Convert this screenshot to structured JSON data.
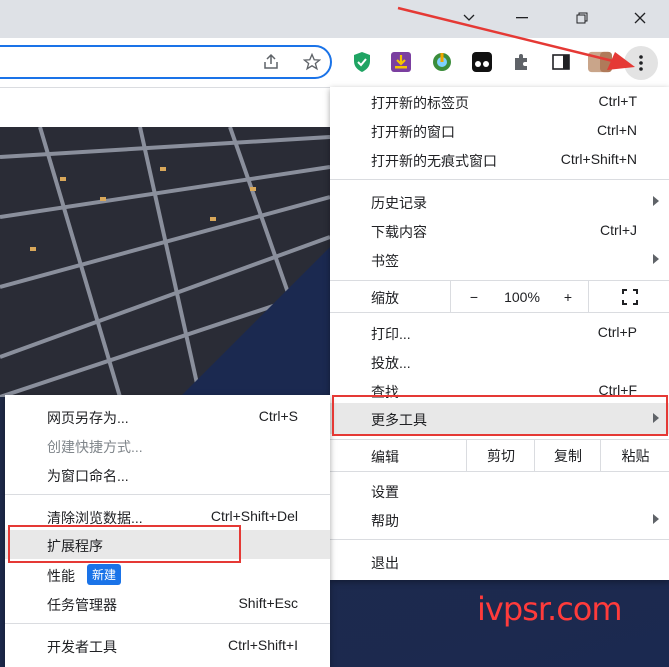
{
  "menu": {
    "items": [
      {
        "label": "打开新的标签页",
        "shortcut": "Ctrl+T"
      },
      {
        "label": "打开新的窗口",
        "shortcut": "Ctrl+N"
      },
      {
        "label": "打开新的无痕式窗口",
        "shortcut": "Ctrl+Shift+N"
      },
      {
        "label": "历史记录",
        "shortcut": ""
      },
      {
        "label": "下载内容",
        "shortcut": "Ctrl+J"
      },
      {
        "label": "书签",
        "shortcut": ""
      },
      {
        "label": "打印...",
        "shortcut": "Ctrl+P"
      },
      {
        "label": "投放...",
        "shortcut": ""
      },
      {
        "label": "查找...",
        "shortcut": "Ctrl+F"
      },
      {
        "label": "更多工具",
        "shortcut": ""
      },
      {
        "label": "设置",
        "shortcut": ""
      },
      {
        "label": "帮助",
        "shortcut": ""
      },
      {
        "label": "退出",
        "shortcut": ""
      }
    ],
    "zoom": {
      "label": "缩放",
      "minus": "−",
      "value": "100%",
      "plus": "+"
    },
    "edit": {
      "label": "编辑",
      "cut": "剪切",
      "copy": "复制",
      "paste": "粘贴"
    }
  },
  "submenu": {
    "items": [
      {
        "label": "网页另存为...",
        "shortcut": "Ctrl+S"
      },
      {
        "label": "创建快捷方式...",
        "shortcut": ""
      },
      {
        "label": "为窗口命名...",
        "shortcut": ""
      },
      {
        "label": "清除浏览数据...",
        "shortcut": "Ctrl+Shift+Del"
      },
      {
        "label": "扩展程序",
        "shortcut": ""
      },
      {
        "label": "性能",
        "shortcut": ""
      },
      {
        "label": "任务管理器",
        "shortcut": "Shift+Esc"
      },
      {
        "label": "开发者工具",
        "shortcut": "Ctrl+Shift+I"
      }
    ],
    "new_badge": "新建"
  },
  "watermark": "ivpsr.com",
  "colors": {
    "accent": "#1a73e8",
    "highlight_box": "#e53935",
    "arrow": "#e53935"
  }
}
